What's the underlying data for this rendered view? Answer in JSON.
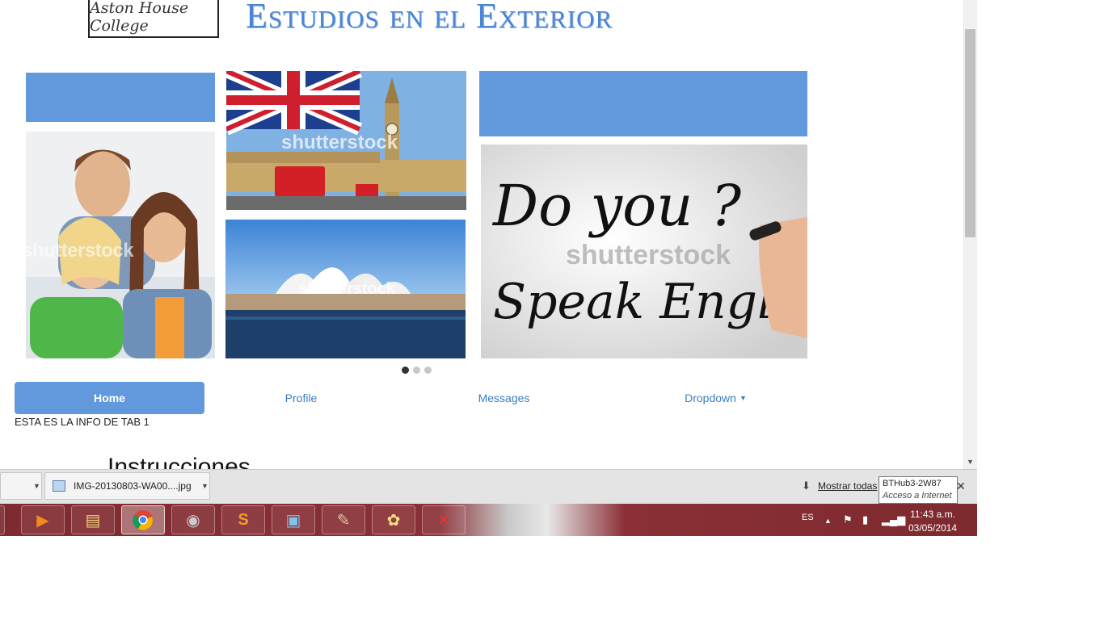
{
  "header": {
    "logo_text": "Aston House College",
    "title": "Estudios en el Exterior"
  },
  "carousel": {
    "watermark": "shutterstock",
    "sign_text_line1": "Do you ?",
    "sign_text_line2": "Speak English",
    "dots": [
      true,
      false,
      false
    ]
  },
  "tabs": {
    "items": [
      {
        "label": "Home"
      },
      {
        "label": "Profile"
      },
      {
        "label": "Messages"
      },
      {
        "label": "Dropdown"
      }
    ],
    "active_content": "ESTA ES LA INFO DE TAB 1"
  },
  "section_heading": "Instrucciones",
  "download_bar": {
    "file_name": "IMG-20130803-WA00....jpg",
    "show_all": "Mostrar todas",
    "tooltip_line1": "BTHub3-2W87",
    "tooltip_line2": "Acceso a Internet"
  },
  "taskbar": {
    "language": "ES",
    "time": "11:43 a.m.",
    "date": "03/05/2014",
    "apps": [
      "app-icon",
      "media-player-icon",
      "file-explorer-icon",
      "chrome-icon",
      "camera-icon",
      "sublime-text-icon",
      "photo-viewer-icon",
      "gimp-icon",
      "paint-icon",
      "acrobat-icon"
    ]
  },
  "colors": {
    "accent": "#6299dd",
    "taskbar": "#7d2a2f"
  }
}
